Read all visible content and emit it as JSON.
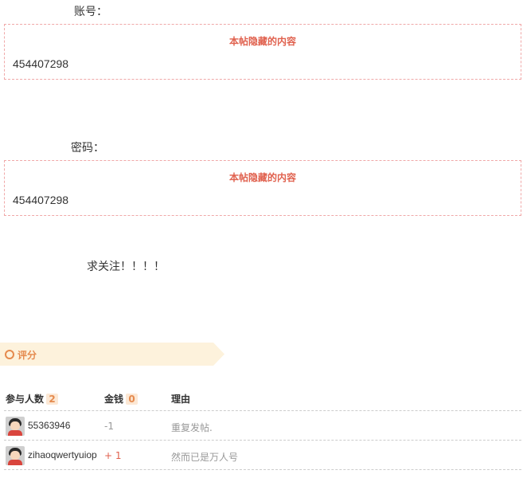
{
  "account": {
    "label": "账号：",
    "hidden_title": "本帖隐藏的内容",
    "value": "454407298"
  },
  "password": {
    "label": "密码：",
    "hidden_title": "本帖隐藏的内容",
    "value": "454407298"
  },
  "follow_text": "求关注！！！！",
  "rating": {
    "title": "评分",
    "header": {
      "participants_label": "参与人数",
      "participants_count": "2",
      "money_label": "金钱",
      "money_total": "0",
      "reason_label": "理由"
    },
    "rows": [
      {
        "user": "55363946",
        "score": "-1",
        "reason": "重复发帖."
      },
      {
        "user": "zihaoqwertyuiop",
        "score": "+ 1",
        "reason": "然而已是万人号"
      }
    ]
  },
  "colors": {
    "accent": "#e58a4e",
    "hidden_title": "#e0614e",
    "banner_bg": "#fdf2dc",
    "dashed_border": "#f0a8a8"
  }
}
